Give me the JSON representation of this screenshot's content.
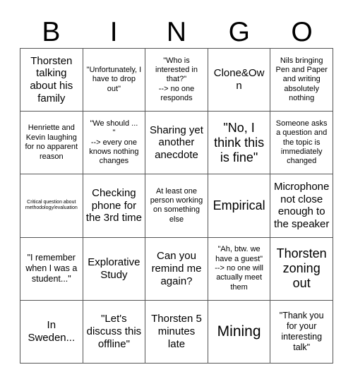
{
  "card": {
    "title_letters": [
      "B",
      "I",
      "N",
      "G",
      "O"
    ],
    "rows": 5,
    "columns": 5,
    "border_color": "#555555",
    "background_color": "#ffffff",
    "text_color": "#000000"
  },
  "cells": [
    {
      "text": "Thorsten talking about his family",
      "size": "md"
    },
    {
      "text": "\"Unfortunately, I have to drop out\"",
      "size": "xs"
    },
    {
      "text": "\"Who is interested in that?\"\n--> no one responds",
      "size": "xs"
    },
    {
      "text": "Clone&Own",
      "size": "md"
    },
    {
      "text": "Nils bringing Pen and Paper and writing absolutely nothing",
      "size": "xs"
    },
    {
      "text": "Henriette and Kevin laughing for no apparent reason",
      "size": "xs"
    },
    {
      "text": "\"We should ...\n\"\n--> every one knows nothing changes",
      "size": "xs"
    },
    {
      "text": "Sharing yet another anecdote",
      "size": "md"
    },
    {
      "text": "\"No, I think this is fine\"",
      "size": "lg"
    },
    {
      "text": "Someone asks a question and the topic is immediately changed",
      "size": "xs"
    },
    {
      "text": "Critical question about methodology/evaluation",
      "size": "xxs"
    },
    {
      "text": "Checking phone for the 3rd time",
      "size": "md"
    },
    {
      "text": "At least one person working on something else",
      "size": "xs"
    },
    {
      "text": "Empirical",
      "size": "lg"
    },
    {
      "text": "Microphone not close enough to the speaker",
      "size": "md"
    },
    {
      "text": "\"I remember when I was a student...\"",
      "size": "sm"
    },
    {
      "text": "Explorative Study",
      "size": "md"
    },
    {
      "text": "Can you remind me again?",
      "size": "md"
    },
    {
      "text": "\"Ah, btw. we have a guest\"\n--> no one will actually meet them",
      "size": "xs"
    },
    {
      "text": "Thorsten zoning out",
      "size": "lg"
    },
    {
      "text": "In Sweden...",
      "size": "md"
    },
    {
      "text": "\"Let's discuss this offline\"",
      "size": "md"
    },
    {
      "text": "Thorsten 5 minutes late",
      "size": "md"
    },
    {
      "text": "Mining",
      "size": "xl"
    },
    {
      "text": "\"Thank you for your interesting talk\"",
      "size": "sm"
    }
  ]
}
